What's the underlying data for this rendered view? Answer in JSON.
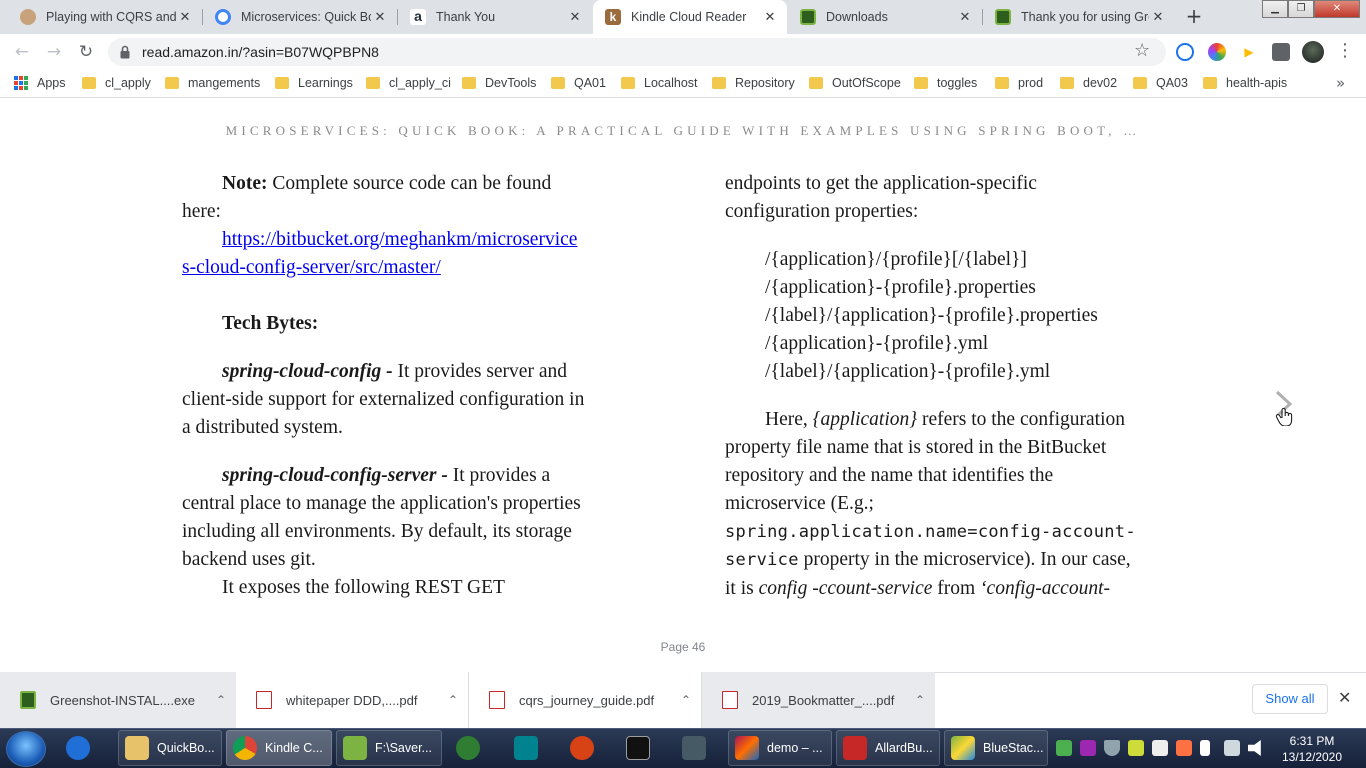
{
  "tabs": [
    {
      "title": "Playing with CQRS and E",
      "favicon_color": "#c8a27a",
      "icon": "avatar-favicon-icon"
    },
    {
      "title": "Microservices: Quick Boo",
      "favicon_color": "#4285f4",
      "icon": "google-favicon-icon"
    },
    {
      "title": "Thank You",
      "favicon_color": "#ff9900",
      "icon": "amazon-favicon-icon"
    },
    {
      "title": "Kindle Cloud Reader",
      "favicon_color": "#9a6b3c",
      "icon": "kindle-favicon-icon"
    },
    {
      "title": "Downloads",
      "favicon_color": "#4caf50",
      "icon": "greenshot-favicon-icon"
    },
    {
      "title": "Thank you for using Gre",
      "favicon_color": "#4caf50",
      "icon": "greenshot-favicon-icon"
    }
  ],
  "tab_close_glyph": "✕",
  "new_tab_glyph": "+",
  "toolbar": {
    "back_glyph": "←",
    "forward_glyph": "→",
    "reload_glyph": "↻",
    "url": "read.amazon.in/?asin=B07WQPBPN8",
    "bookmark_star": "☆",
    "menu_glyph": "⋮"
  },
  "bookmarks": {
    "apps_label": "Apps",
    "items": [
      "cl_apply",
      "mangements",
      "Learnings",
      "cl_apply_ci",
      "DevTools",
      "QA01",
      "Localhost",
      "Repository",
      "OutOfScope",
      "toggles",
      "prod",
      "dev02",
      "QA03",
      "health-apis"
    ],
    "more_glyph": "»"
  },
  "book": {
    "title": "MICROSERVICES: QUICK BOOK: A PRACTICAL GUIDE WITH EXAMPLES USING SPRING BOOT, …",
    "left": {
      "note_label": "Note:",
      "note_text": " Complete source code can be found",
      "note_text2": "here:",
      "link_line1": "https://bitbucket.org/meghankm/microservice",
      "link_line2": "s-cloud-config-server/src/master/",
      "tech_bytes": "Tech Bytes:",
      "scc_term": "spring-cloud-config -",
      "scc_text1": " It provides server and",
      "scc_text2": "client-side support for externalized configuration in",
      "scc_text3": "a distributed system.",
      "sccs_term": "spring-cloud-config-server -",
      "sccs_text1": " It provides a",
      "sccs_text2": "central place to manage the application's properties",
      "sccs_text3": "including all environments. By default, its storage",
      "sccs_text4": "backend uses git.",
      "exposes": "It exposes the following REST GET"
    },
    "right": {
      "line1": "endpoints to get the application-specific",
      "line2": "configuration properties:",
      "endpoints": [
        "/{application}/{profile}[/{label}]",
        "/{application}-{profile}.properties",
        "/{label}/{application}-{profile}.properties",
        "/{application}-{profile}.yml",
        "/{label}/{application}-{profile}.yml"
      ],
      "here_a": "Here, ",
      "here_b": "{application}",
      "here_c": " refers to the configuration",
      "line_p2": "property file name that is stored in the BitBucket",
      "line_p3": "repository and the name that identifies the",
      "line_p4": "microservice (E.g.;",
      "code1": "spring.application.name=config-account-",
      "code2": "service",
      "line_p6": " property in the microservice). In our case,",
      "line_p7a": "it is ",
      "line_p7b": "config -ccount-service",
      "line_p7c": " from ",
      "line_p7d": "‘config-account-"
    },
    "page_label": "Page 46"
  },
  "downloads": {
    "items": [
      {
        "name": "Greenshot-INSTAL....exe",
        "icon": "greenshot-installer-icon"
      },
      {
        "name": "whitepaper DDD,....pdf",
        "icon": "pdf-icon"
      },
      {
        "name": "cqrs_journey_guide.pdf",
        "icon": "pdf-icon"
      },
      {
        "name": "2019_Bookmatter_....pdf",
        "icon": "pdf-icon"
      }
    ],
    "chevron": "⌃",
    "show_all": "Show all",
    "close_glyph": "✕"
  },
  "taskbar": {
    "items": [
      {
        "label": "",
        "icon": "program-icon",
        "color": "#1f6fd6"
      },
      {
        "label": "QuickBo...",
        "icon": "folder-icon",
        "color": "#e8c26a"
      },
      {
        "label": "Kindle C...",
        "icon": "chrome-icon",
        "color": "#db4437"
      },
      {
        "label": "F:\\Saver...",
        "icon": "notepadpp-icon",
        "color": "#7cb342"
      },
      {
        "label": "",
        "icon": "timer-icon",
        "color": "#2e7d32"
      },
      {
        "label": "",
        "icon": "editor-icon",
        "color": "#00838f"
      },
      {
        "label": "",
        "icon": "snipping-tool-icon",
        "color": "#d84315"
      },
      {
        "label": "",
        "icon": "cmd-icon",
        "color": "#111111"
      },
      {
        "label": "",
        "icon": "calculator-icon",
        "color": "#455a64"
      },
      {
        "label": "demo – ...",
        "icon": "intellij-icon",
        "color": "#ad1457"
      },
      {
        "label": "AllardBu...",
        "icon": "acrobat-icon",
        "color": "#c62828"
      },
      {
        "label": "BlueStac...",
        "icon": "bluestacks-icon",
        "color": "#7cb342"
      }
    ],
    "clock_time": "6:31 PM",
    "clock_date": "13/12/2020"
  }
}
